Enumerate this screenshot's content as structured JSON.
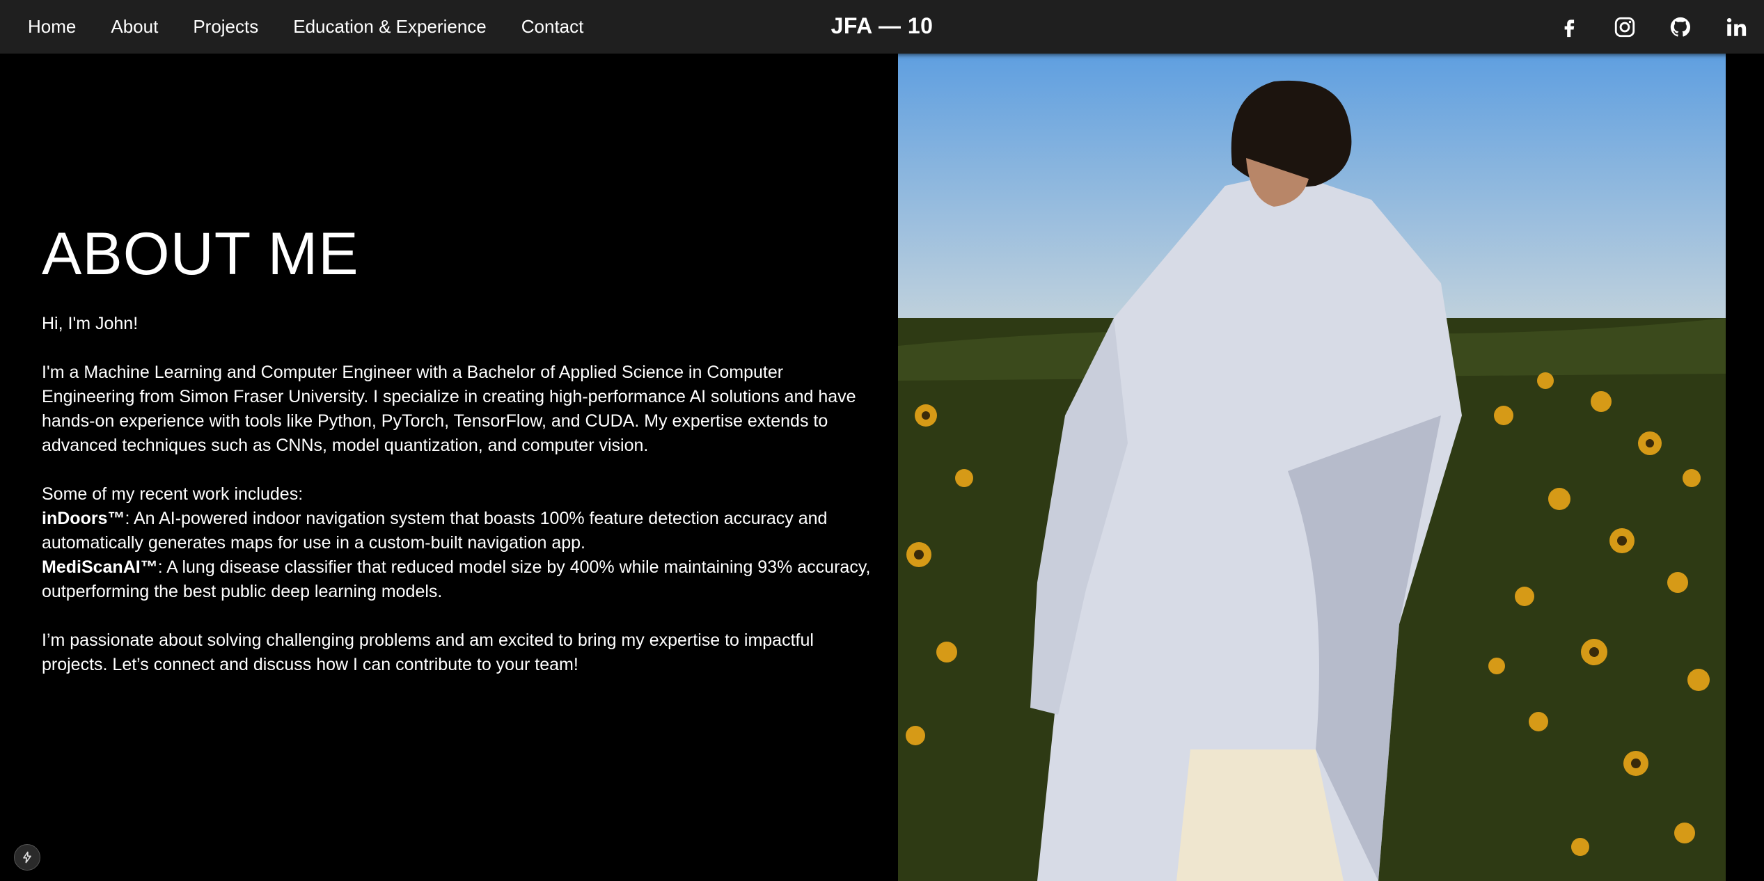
{
  "nav": {
    "links": [
      "Home",
      "About",
      "Projects",
      "Education & Experience",
      "Contact"
    ],
    "brand": "JFA — 10"
  },
  "social": [
    "facebook-icon",
    "instagram-icon",
    "github-icon",
    "linkedin-icon"
  ],
  "about": {
    "heading": "ABOUT ME",
    "greeting": "Hi, I'm John!",
    "intro": "I'm a Machine Learning and Computer Engineer with a Bachelor of Applied Science in Computer Engineering from Simon Fraser University. I specialize in creating high-performance AI solutions and have hands-on experience with tools like Python, PyTorch, TensorFlow, and CUDA. My expertise extends to advanced techniques such as CNNs, model quantization, and computer vision.",
    "work_intro": "Some of my recent work includes:",
    "projects": [
      {
        "name": "inDoors™",
        "desc": ": An AI-powered indoor navigation system that boasts 100% feature detection accuracy and automatically generates maps for use in a custom-built navigation app."
      },
      {
        "name": "MediScanAI™",
        "desc": ": A lung disease classifier that reduced model size by 400% while maintaining 93% accuracy, outperforming the best public deep learning models."
      }
    ],
    "closing": "I’m passionate about solving challenging problems and am excited to bring my expertise to impactful projects. Let’s connect and discuss how I can contribute to your team!"
  },
  "floating_button_icon": "lightning-icon"
}
